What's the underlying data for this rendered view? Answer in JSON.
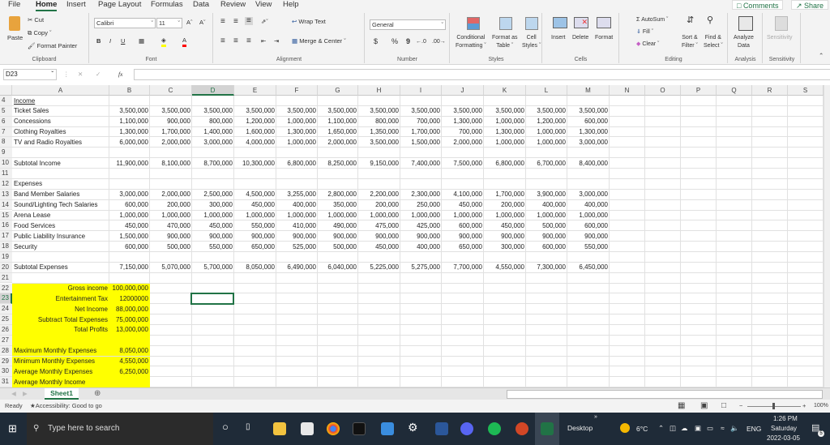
{
  "menu": {
    "tabs": [
      "File",
      "Home",
      "Insert",
      "Page Layout",
      "Formulas",
      "Data",
      "Review",
      "View",
      "Help"
    ],
    "active_tab": "Home",
    "comments_label": "Comments",
    "share_label": "Share"
  },
  "ribbon": {
    "clipboard": {
      "paste": "Paste",
      "cut": "Cut",
      "copy": "Copy",
      "format_painter": "Format Painter",
      "label": "Clipboard"
    },
    "font": {
      "name": "Calibri",
      "size": "11",
      "bold": "B",
      "italic": "I",
      "underline": "U",
      "label": "Font",
      "fill_color": "#ffff00",
      "font_color": "#ff0000"
    },
    "alignment": {
      "wrap_text": "Wrap Text",
      "merge_center": "Merge & Center",
      "label": "Alignment"
    },
    "number": {
      "format": "General",
      "currency": "$",
      "percent": "%",
      "comma": "9",
      "label": "Number"
    },
    "styles": {
      "conditional": "Conditional",
      "conditional2": "Formatting",
      "format_table": "Format as",
      "format_table2": "Table",
      "cell_styles": "Cell",
      "cell_styles2": "Styles",
      "label": "Styles"
    },
    "cells": {
      "insert": "Insert",
      "delete": "Delete",
      "format": "Format",
      "label": "Cells"
    },
    "editing": {
      "autosum": "AutoSum",
      "fill": "Fill",
      "clear": "Clear",
      "sort": "Sort &",
      "sort2": "Filter",
      "find": "Find &",
      "find2": "Select",
      "label": "Editing"
    },
    "analysis": {
      "analyze": "Analyze",
      "analyze2": "Data",
      "label": "Analysis"
    },
    "sensitivity": {
      "btn": "Sensitivity",
      "label": "Sensitivity"
    }
  },
  "formula_bar": {
    "name_box": "D23",
    "fx": "fx",
    "value": ""
  },
  "columns": [
    "A",
    "B",
    "C",
    "D",
    "E",
    "F",
    "G",
    "H",
    "I",
    "J",
    "K",
    "L",
    "M",
    "N",
    "O",
    "P",
    "Q",
    "R",
    "S"
  ],
  "selected_column": "D",
  "selected_row": "23",
  "rows": [
    {
      "n": "4",
      "label": "Income",
      "underline": true,
      "values": []
    },
    {
      "n": "5",
      "label": "Ticket Sales",
      "values": [
        "3,500,000",
        "3,500,000",
        "3,500,000",
        "3,500,000",
        "3,500,000",
        "3,500,000",
        "3,500,000",
        "3,500,000",
        "3,500,000",
        "3,500,000",
        "3,500,000",
        "3,500,000"
      ]
    },
    {
      "n": "6",
      "label": "Concessions",
      "values": [
        "1,100,000",
        "900,000",
        "800,000",
        "1,200,000",
        "1,000,000",
        "1,100,000",
        "800,000",
        "700,000",
        "1,300,000",
        "1,000,000",
        "1,200,000",
        "600,000"
      ]
    },
    {
      "n": "7",
      "label": "Clothing Royalties",
      "values": [
        "1,300,000",
        "1,700,000",
        "1,400,000",
        "1,600,000",
        "1,300,000",
        "1,650,000",
        "1,350,000",
        "1,700,000",
        "700,000",
        "1,300,000",
        "1,000,000",
        "1,300,000"
      ]
    },
    {
      "n": "8",
      "label": "TV and Radio Royalties",
      "values": [
        "6,000,000",
        "2,000,000",
        "3,000,000",
        "4,000,000",
        "1,000,000",
        "2,000,000",
        "3,500,000",
        "1,500,000",
        "2,000,000",
        "1,000,000",
        "1,000,000",
        "3,000,000"
      ]
    },
    {
      "n": "9",
      "label": "",
      "values": []
    },
    {
      "n": "10",
      "label": "Subtotal Income",
      "values": [
        "11,900,000",
        "8,100,000",
        "8,700,000",
        "10,300,000",
        "6,800,000",
        "8,250,000",
        "9,150,000",
        "7,400,000",
        "7,500,000",
        "6,800,000",
        "6,700,000",
        "8,400,000"
      ]
    },
    {
      "n": "11",
      "label": "",
      "values": []
    },
    {
      "n": "12",
      "label": "Expenses",
      "values": []
    },
    {
      "n": "13",
      "label": "Band Member Salaries",
      "values": [
        "3,000,000",
        "2,000,000",
        "2,500,000",
        "4,500,000",
        "3,255,000",
        "2,800,000",
        "2,200,000",
        "2,300,000",
        "4,100,000",
        "1,700,000",
        "3,900,000",
        "3,000,000"
      ]
    },
    {
      "n": "14",
      "label": "Sound/Lighting Tech Salaries",
      "values": [
        "600,000",
        "200,000",
        "300,000",
        "450,000",
        "400,000",
        "350,000",
        "200,000",
        "250,000",
        "450,000",
        "200,000",
        "400,000",
        "400,000"
      ]
    },
    {
      "n": "15",
      "label": "Arena Lease",
      "values": [
        "1,000,000",
        "1,000,000",
        "1,000,000",
        "1,000,000",
        "1,000,000",
        "1,000,000",
        "1,000,000",
        "1,000,000",
        "1,000,000",
        "1,000,000",
        "1,000,000",
        "1,000,000"
      ]
    },
    {
      "n": "16",
      "label": "Food Services",
      "values": [
        "450,000",
        "470,000",
        "450,000",
        "550,000",
        "410,000",
        "490,000",
        "475,000",
        "425,000",
        "600,000",
        "450,000",
        "500,000",
        "600,000"
      ]
    },
    {
      "n": "17",
      "label": "Public Liability Insurance",
      "values": [
        "1,500,000",
        "900,000",
        "900,000",
        "900,000",
        "900,000",
        "900,000",
        "900,000",
        "900,000",
        "900,000",
        "900,000",
        "900,000",
        "900,000"
      ]
    },
    {
      "n": "18",
      "label": "Security",
      "values": [
        "600,000",
        "500,000",
        "550,000",
        "650,000",
        "525,000",
        "500,000",
        "450,000",
        "400,000",
        "650,000",
        "300,000",
        "600,000",
        "550,000"
      ]
    },
    {
      "n": "19",
      "label": "",
      "values": []
    },
    {
      "n": "20",
      "label": "Subtotal Expenses",
      "values": [
        "7,150,000",
        "5,070,000",
        "5,700,000",
        "8,050,000",
        "6,490,000",
        "6,040,000",
        "5,225,000",
        "5,275,000",
        "7,700,000",
        "4,550,000",
        "7,300,000",
        "6,450,000"
      ]
    },
    {
      "n": "21",
      "label": "",
      "values": []
    }
  ],
  "summary": [
    {
      "n": "22",
      "label": "Gross income",
      "value": "100,000,000"
    },
    {
      "n": "23",
      "label": "Entertainment Tax",
      "value": "12000000"
    },
    {
      "n": "24",
      "label": "Net Income",
      "value": "88,000,000"
    },
    {
      "n": "25",
      "label": "Subtract Total Expenses",
      "value": "75,000,000"
    },
    {
      "n": "26",
      "label": "Total Profits",
      "value": "13,000,000"
    },
    {
      "n": "27",
      "label": "",
      "value": ""
    },
    {
      "n": "28",
      "label": "Maximum Monthly Expenses",
      "value": "8,050,000"
    },
    {
      "n": "29",
      "label": "Minimum Monthly Expenses",
      "value": "4,550,000"
    },
    {
      "n": "30",
      "label": "Average Monthly Expenses",
      "value": "6,250,000"
    },
    {
      "n": "31",
      "label": "Average Monthly Income",
      "value": ""
    }
  ],
  "highlight_color": "#ffff00",
  "sheet_tabs": [
    "Sheet1"
  ],
  "status": {
    "ready": "Ready",
    "accessibility": "Accessibility: Good to go",
    "zoom": "100%"
  },
  "taskbar": {
    "search_placeholder": "Type here to search",
    "desktop": "Desktop",
    "weather": "6°C",
    "lang": "ENG",
    "time": "1:26 PM",
    "day": "Saturday",
    "date": "2022-03-05",
    "notif_count": "5"
  }
}
